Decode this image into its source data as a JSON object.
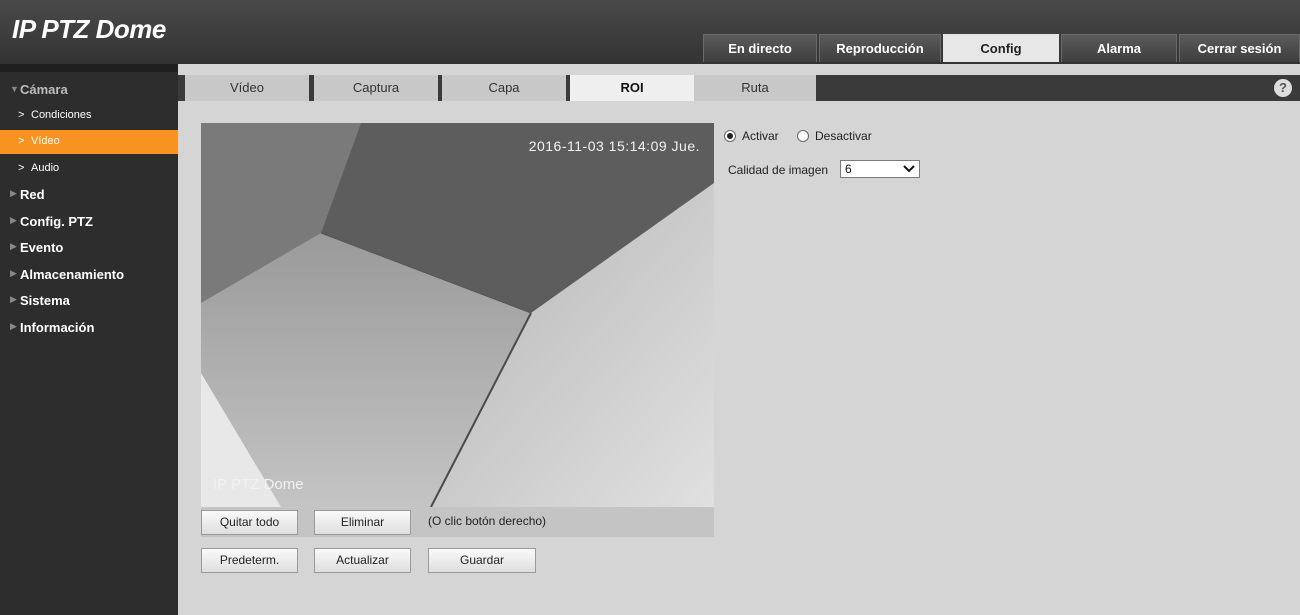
{
  "header": {
    "brand": "IP PTZ Dome",
    "tabs": [
      {
        "label": "En directo"
      },
      {
        "label": "Reproducción"
      },
      {
        "label": "Config"
      },
      {
        "label": "Alarma"
      },
      {
        "label": "Cerrar sesión"
      }
    ],
    "active_tab": "Config"
  },
  "sidebar": {
    "camera": {
      "label": "Cámara",
      "children": [
        {
          "label": "Condiciones"
        },
        {
          "label": "Vídeo"
        },
        {
          "label": "Audio"
        }
      ],
      "active_child": "Vídeo"
    },
    "sections": [
      {
        "label": "Red"
      },
      {
        "label": "Config. PTZ"
      },
      {
        "label": "Evento"
      },
      {
        "label": "Almacenamiento"
      },
      {
        "label": "Sistema"
      },
      {
        "label": "Información"
      }
    ]
  },
  "subnav": {
    "tabs": [
      {
        "label": "Vídeo"
      },
      {
        "label": "Captura"
      },
      {
        "label": "Capa"
      },
      {
        "label": "ROI"
      },
      {
        "label": "Ruta"
      }
    ],
    "active_tab": "ROI",
    "help_icon": "?"
  },
  "preview": {
    "timestamp": "2016-11-03 15:14:09 Jue.",
    "watermark": "IP PTZ Dome"
  },
  "roi_actions": {
    "clear_all": "Quitar todo",
    "delete": "Eliminar",
    "hint": "(O clic botón derecho)"
  },
  "settings": {
    "enable_label": "Activar",
    "disable_label": "Desactivar",
    "enabled": true,
    "quality_label": "Calidad de imagen",
    "quality_value": "6"
  },
  "footer_buttons": {
    "default": "Predeterm.",
    "refresh": "Actualizar",
    "save": "Guardar"
  },
  "colors": {
    "accent": "#f7931e",
    "header_bg": "#3a3a3a",
    "sidebar_bg": "#2d2d2d",
    "page_bg": "#d5d5d5"
  }
}
